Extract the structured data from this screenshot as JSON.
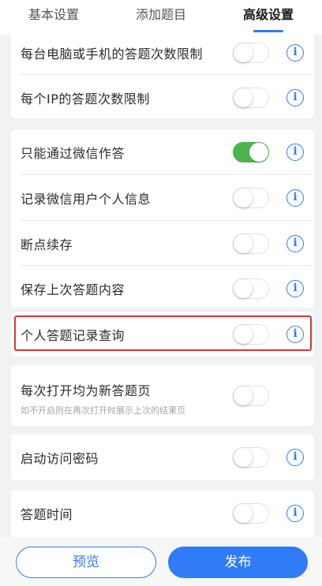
{
  "tabs": [
    {
      "label": "基本设置",
      "active": false
    },
    {
      "label": "添加题目",
      "active": false
    },
    {
      "label": "高级设置",
      "active": true
    }
  ],
  "settings": [
    {
      "label": "每台电脑或手机的答题次数限制",
      "enabled": false,
      "has_info": true
    },
    {
      "label": "每个IP的答题次数限制",
      "enabled": false,
      "has_info": true
    },
    {
      "label": "只能通过微信作答",
      "enabled": true,
      "has_info": true
    },
    {
      "label": "记录微信用户个人信息",
      "enabled": false,
      "has_info": true
    },
    {
      "label": "断点续存",
      "enabled": false,
      "has_info": true
    },
    {
      "label": "保存上次答题内容",
      "enabled": false,
      "has_info": true
    },
    {
      "label": "个人答题记录查询",
      "enabled": false,
      "has_info": true,
      "highlighted": true
    },
    {
      "label": "每次打开均为新答题页",
      "sublabel": "如不开启则在再次打开时展示上次的结果页",
      "enabled": false,
      "has_info": false
    },
    {
      "label": "启动访问密码",
      "enabled": false,
      "has_info": true
    },
    {
      "label": "答题时间",
      "enabled": false,
      "has_info": true
    }
  ],
  "info_icon": {
    "name": "info-icon",
    "glyph": "i",
    "color": "#2f7cf6"
  },
  "colors": {
    "accent": "#2f7cf6",
    "toggle_on": "#4cb44f",
    "highlight_border": "#d9362f"
  },
  "footer": {
    "preview_label": "预览",
    "publish_label": "发布"
  }
}
